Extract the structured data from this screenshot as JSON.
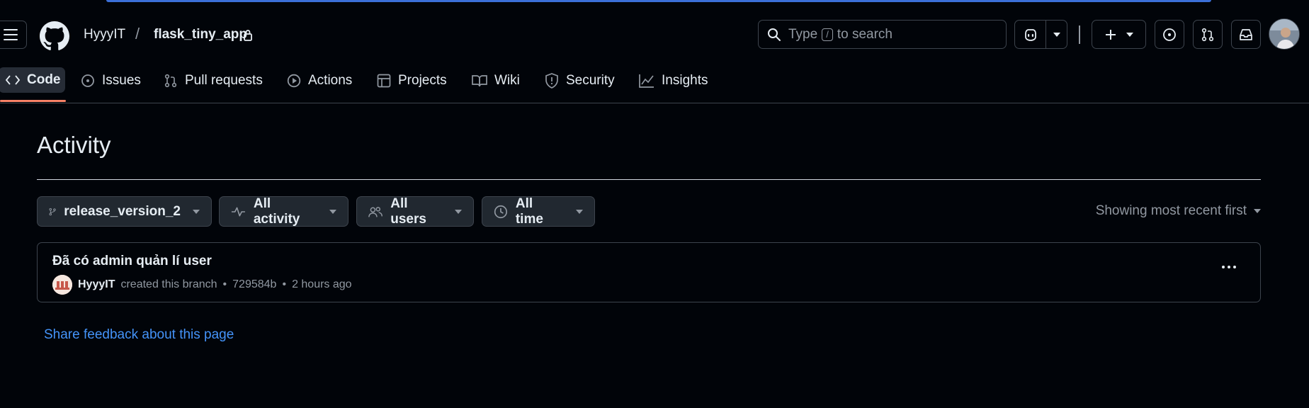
{
  "header": {
    "owner": "HyyyIT",
    "separator": "/",
    "repo": "flask_tiny_app",
    "search_prefix": "Type",
    "search_key": "/",
    "search_suffix": "to search"
  },
  "tabs": [
    {
      "label": "Code",
      "icon": "code-icon",
      "active": true
    },
    {
      "label": "Issues",
      "icon": "issue-opened-icon"
    },
    {
      "label": "Pull requests",
      "icon": "git-pull-request-icon"
    },
    {
      "label": "Actions",
      "icon": "play-icon"
    },
    {
      "label": "Projects",
      "icon": "table-icon"
    },
    {
      "label": "Wiki",
      "icon": "book-icon"
    },
    {
      "label": "Security",
      "icon": "shield-icon"
    },
    {
      "label": "Insights",
      "icon": "graph-icon"
    }
  ],
  "page": {
    "title": "Activity",
    "sort_label": "Showing most recent first",
    "feedback_link": "Share feedback about this page"
  },
  "filters": {
    "branch": "release_version_2",
    "activity": "All activity",
    "users": "All users",
    "time": "All time"
  },
  "activity_items": [
    {
      "title": "Đã có admin quản lí user",
      "user": "HyyyIT",
      "action": "created this branch",
      "dot1": "•",
      "commit": "729584b",
      "dot2": "•",
      "time": "2 hours ago"
    }
  ],
  "colors": {
    "background": "#010409",
    "border": "#3d444d",
    "link": "#4493f8",
    "active_tab_underline": "#f78166"
  }
}
